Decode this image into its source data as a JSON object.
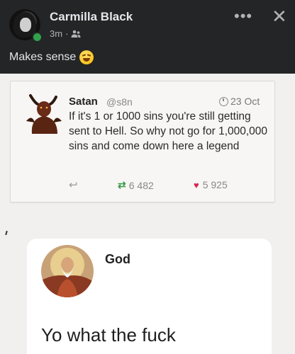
{
  "post": {
    "author": "Carmilla Black",
    "time": "3m",
    "separator": "·",
    "caption": "Makes sense",
    "emoji": "rolling-on-floor-laughing-emoji"
  },
  "icons": {
    "more": "more-options-icon",
    "close": "close-icon",
    "audience": "friends-icon"
  },
  "tweet": {
    "name": "Satan",
    "handle": "@s8n",
    "date": "23 Oct",
    "text": "If it's 1 or 1000 sins you're still getting sent to Hell. So why not go for 1,000,000 sins and come down here a legend",
    "retweets": "6 482",
    "likes": "5 925"
  },
  "reply": {
    "name": "God",
    "message": "Yo what the fuck"
  },
  "colors": {
    "background": "#242526",
    "text_primary": "#e4e6eb",
    "text_secondary": "#b0b3b8",
    "online": "#31a24c",
    "retweet_green": "#3a9a4a",
    "like_red": "#d6264b"
  }
}
